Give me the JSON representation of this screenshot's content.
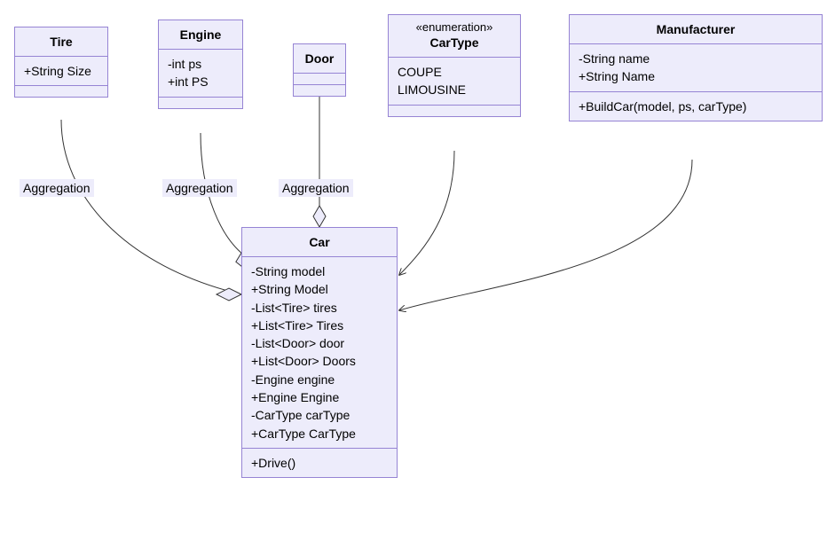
{
  "classes": {
    "tire": {
      "name": "Tire",
      "attributes": [
        "+String Size"
      ],
      "methods": []
    },
    "engine": {
      "name": "Engine",
      "attributes": [
        "-int ps",
        "+int PS"
      ],
      "methods": []
    },
    "door": {
      "name": "Door",
      "attributes": [],
      "methods": []
    },
    "cartype": {
      "stereotype": "«enumeration»",
      "name": "CarType",
      "values": [
        "COUPE",
        "LIMOUSINE"
      ],
      "methods": []
    },
    "manufacturer": {
      "name": "Manufacturer",
      "attributes": [
        "-String name",
        "+String Name"
      ],
      "methods": [
        "+BuildCar(model, ps, carType)"
      ]
    },
    "car": {
      "name": "Car",
      "attributes": [
        "-String model",
        "+String Model",
        "-List<Tire> tires",
        "+List<Tire> Tires",
        "-List<Door> door",
        "+List<Door> Doors",
        "-Engine engine",
        "+Engine Engine",
        "-CarType carType",
        "+CarType CarType"
      ],
      "methods": [
        "+Drive()"
      ]
    }
  },
  "labels": {
    "aggTire": "Aggregation",
    "aggEngine": "Aggregation",
    "aggDoor": "Aggregation"
  },
  "chart_data": {
    "type": "uml_class_diagram",
    "classes": [
      {
        "name": "Tire",
        "attributes": [
          "+String Size"
        ],
        "methods": []
      },
      {
        "name": "Engine",
        "attributes": [
          "-int ps",
          "+int PS"
        ],
        "methods": []
      },
      {
        "name": "Door",
        "attributes": [],
        "methods": []
      },
      {
        "name": "CarType",
        "stereotype": "enumeration",
        "values": [
          "COUPE",
          "LIMOUSINE"
        ]
      },
      {
        "name": "Manufacturer",
        "attributes": [
          "-String name",
          "+String Name"
        ],
        "methods": [
          "+BuildCar(model, ps, carType)"
        ]
      },
      {
        "name": "Car",
        "attributes": [
          "-String model",
          "+String Model",
          "-List<Tire> tires",
          "+List<Tire> Tires",
          "-List<Door> door",
          "+List<Door> Doors",
          "-Engine engine",
          "+Engine Engine",
          "-CarType carType",
          "+CarType CarType"
        ],
        "methods": [
          "+Drive()"
        ]
      }
    ],
    "relationships": [
      {
        "from": "Tire",
        "to": "Car",
        "type": "aggregation",
        "label": "Aggregation"
      },
      {
        "from": "Engine",
        "to": "Car",
        "type": "aggregation",
        "label": "Aggregation"
      },
      {
        "from": "Door",
        "to": "Car",
        "type": "aggregation",
        "label": "Aggregation"
      },
      {
        "from": "CarType",
        "to": "Car",
        "type": "association"
      },
      {
        "from": "Manufacturer",
        "to": "Car",
        "type": "association"
      }
    ]
  }
}
